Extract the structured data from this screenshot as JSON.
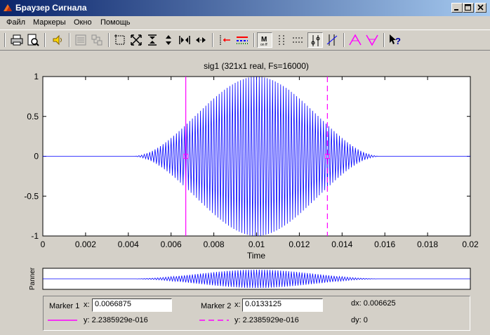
{
  "window": {
    "title": "Браузер Сигнала"
  },
  "menu": [
    {
      "label": "Файл"
    },
    {
      "label": "Маркеры"
    },
    {
      "label": "Окно"
    },
    {
      "label": "Помощь"
    }
  ],
  "toolbar": {
    "buttons": [
      "print-icon",
      "print-preview-icon",
      "speaker-icon",
      "array-signals-icon",
      "link-icon",
      "zoom-box-icon",
      "full-view-icon",
      "zoom-in-vertical-icon",
      "zoom-out-vertical-icon",
      "zoom-in-horizontal-icon",
      "zoom-out-horizontal-icon",
      "markers-icon",
      "line-properties-icon",
      "marker-on-icon",
      "vertical-markers-icon",
      "horizontal-markers-icon",
      "track-markers-icon",
      "slope-markers-icon",
      "peaks-icon",
      "valleys-icon",
      "context-help-icon"
    ]
  },
  "colors": {
    "signal": "#0000ff",
    "marker": "#ff00ff"
  },
  "chart_data": {
    "type": "line",
    "title": "sig1 (321x1 real, Fs=16000)",
    "xlabel": "Time",
    "ylabel": "",
    "xlim": [
      0,
      0.02
    ],
    "ylim": [
      -1,
      1
    ],
    "x_ticks": [
      "0",
      "0.002",
      "0.004",
      "0.006",
      "0.008",
      "0.01",
      "0.012",
      "0.014",
      "0.016",
      "0.018",
      "0.02"
    ],
    "y_ticks": [
      "1",
      "0.5",
      "0",
      "-0.5",
      "-1"
    ],
    "grid": false,
    "signal": {
      "fs": 16000,
      "samples": 321,
      "description_values": {
        "burst_start": 0.0042,
        "burst_end": 0.0158,
        "peak_time": 0.01,
        "peak_amplitude": 1
      }
    },
    "markers": [
      {
        "name": "Marker 1",
        "x": 0.0066875,
        "style": "solid"
      },
      {
        "name": "Marker 2",
        "x": 0.0133125,
        "style": "dashed"
      }
    ]
  },
  "panner": {
    "label": "Panner"
  },
  "markerinfo": {
    "m1_label": "Marker 1",
    "m1_x_label": "x:",
    "m1_x_value": "0.0066875",
    "m1_y_text": "y: 2.2385929e-016",
    "m2_label": "Marker 2",
    "m2_x_label": "x:",
    "m2_x_value": "0.0133125",
    "m2_y_text": "y: 2.2385929e-016",
    "dx_text": "dx: 0.006625",
    "dy_text": "dy: 0"
  }
}
